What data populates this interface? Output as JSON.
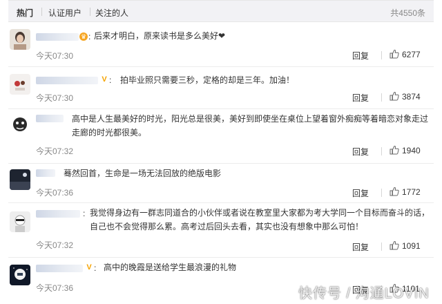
{
  "tabs": {
    "hot": "热门",
    "verified": "认证用户",
    "following": "关注的人",
    "total": "共4550条"
  },
  "reply_label": "回复",
  "comments": [
    {
      "text": "后来才明白，原来读书是多么美好❤",
      "time": "今天07:30",
      "likes": "6277",
      "badge": "orange-crown"
    },
    {
      "text": "拍毕业照只需要三秒，定格的却是三年。加油！",
      "time": "今天07:30",
      "likes": "3874",
      "badge": "v-verified"
    },
    {
      "text": "高中是人生最美好的时光，阳光总是很美，美好到即使坐在桌位上望着窗外痴痴等着暗恋对象走过走廊的时光都很美。",
      "time": "今天07:32",
      "likes": "1940",
      "badge": ""
    },
    {
      "text": "蓦然回首，生命是一场无法回放的绝版电影",
      "time": "今天07:36",
      "likes": "1772",
      "badge": ""
    },
    {
      "text": "我觉得身边有一群志同道合的小伙伴或者说在教室里大家都为考大学同一个目标而奋斗的话，自己也不会觉得那么累。高考过后回头去看，其实也没有想象中那么可怕！",
      "time": "今天07:32",
      "likes": "1091",
      "badge": ""
    },
    {
      "text": "高中的晚霞是送给学生最浪漫的礼物",
      "time": "今天07:36",
      "likes": "1101",
      "badge": ""
    }
  ],
  "watermark": "快传号 / 沟通LOVIN",
  "colors": {
    "accent": "#f6a623",
    "muted": "#888888",
    "tab_bg": "#f2f2f5"
  }
}
